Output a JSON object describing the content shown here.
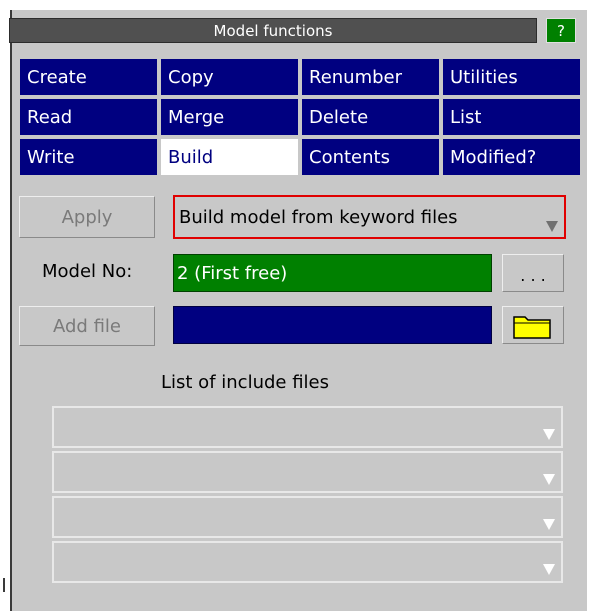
{
  "panel": {
    "title": "Model functions",
    "help_label": "?"
  },
  "functions": [
    {
      "label": "Create",
      "selected": false
    },
    {
      "label": "Copy",
      "selected": false
    },
    {
      "label": "Renumber",
      "selected": false
    },
    {
      "label": "Utilities",
      "selected": false
    },
    {
      "label": "Read",
      "selected": false
    },
    {
      "label": "Merge",
      "selected": false
    },
    {
      "label": "Delete",
      "selected": false
    },
    {
      "label": "List",
      "selected": false
    },
    {
      "label": "Write",
      "selected": false
    },
    {
      "label": "Build",
      "selected": true
    },
    {
      "label": "Contents",
      "selected": false
    },
    {
      "label": "Modified?",
      "selected": false
    }
  ],
  "apply": {
    "label": "Apply"
  },
  "mode_select": {
    "value": "Build model from keyword files",
    "icon": "dropdown-arrow-icon"
  },
  "model_no": {
    "label": "Model No:",
    "value": "2 (First free)",
    "browse_label": ". . ."
  },
  "add_file": {
    "label": "Add file",
    "value": "",
    "browse_icon": "folder-icon"
  },
  "include_files": {
    "heading": "List of include files",
    "slots": [
      "",
      "",
      "",
      ""
    ]
  },
  "colors": {
    "panel_bg": "#c8c8c8",
    "function_button": "#000080",
    "selected_function": "#ffffff",
    "help_button": "#008000",
    "model_field": "#008000",
    "file_field": "#000080",
    "folder_fill": "#ffff00",
    "mode_select_border": "#e00000"
  }
}
